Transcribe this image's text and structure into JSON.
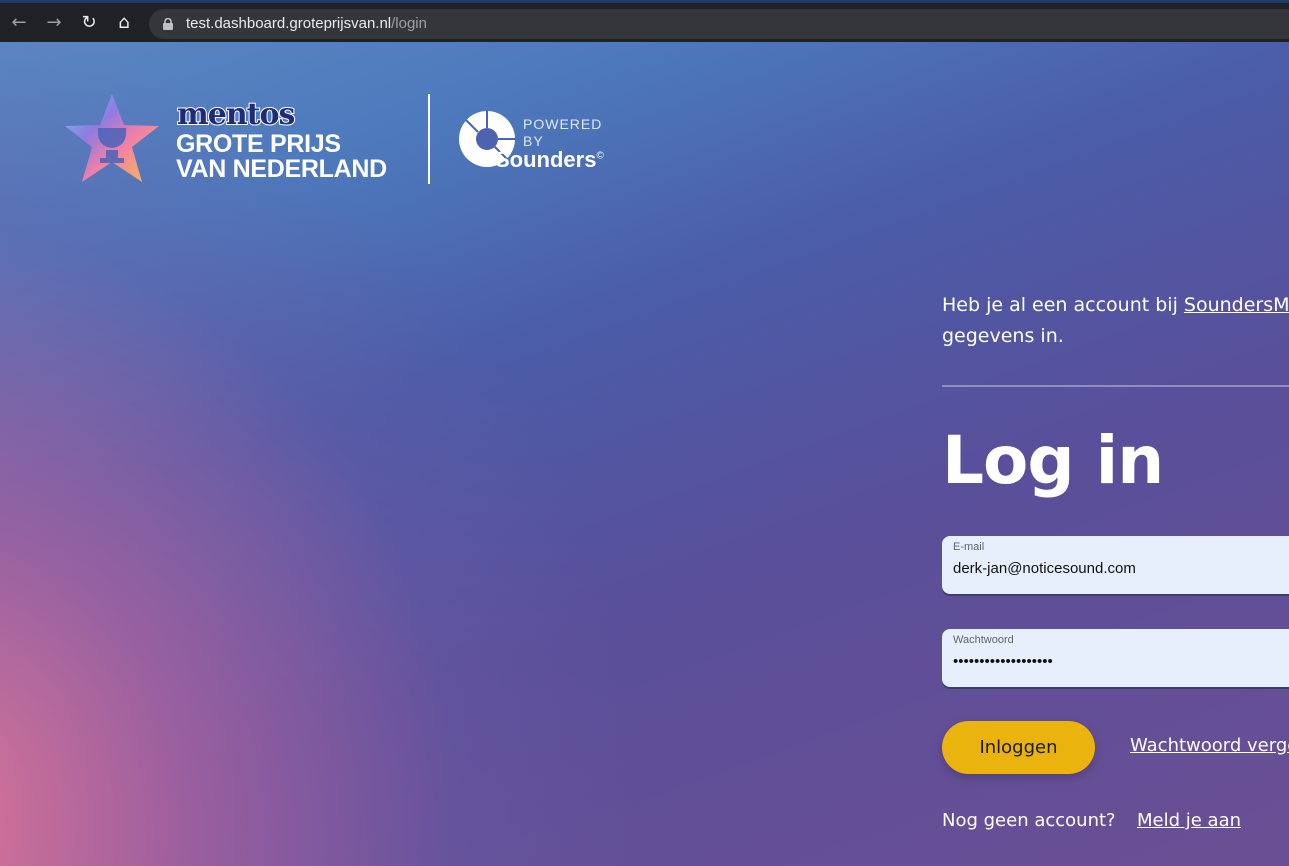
{
  "browser": {
    "url_domain": "test.dashboard.groteprijsvan.nl",
    "url_path": "/login",
    "back_icon": "arrow-left-icon",
    "forward_icon": "arrow-right-icon",
    "reload_icon": "reload-icon",
    "home_icon": "home-icon"
  },
  "branding": {
    "mentos": "mentos",
    "title_line1": "GROTE PRIJS",
    "title_line2": "VAN NEDERLAND",
    "powered_line1": "POWERED",
    "powered_line2": "BY",
    "sounders": "Sounders",
    "copyright": "©"
  },
  "login": {
    "intro_prefix": "Heb je al een account bij ",
    "intro_link": "SoundersMusic",
    "intro_suffix": "gegevens in.",
    "title": "Log in",
    "email_label": "E-mail",
    "email_value": "derk-jan@noticesound.com",
    "password_label": "Wachtwoord",
    "password_value": "•••••••••••••••••••",
    "submit_label": "Inloggen",
    "forgot_label": "Wachtwoord vergeten?",
    "no_account_text": "Nog geen account?",
    "signup_label": "Meld je aan"
  },
  "colors": {
    "accent_button": "#eab30e",
    "input_background": "#e8effc"
  }
}
